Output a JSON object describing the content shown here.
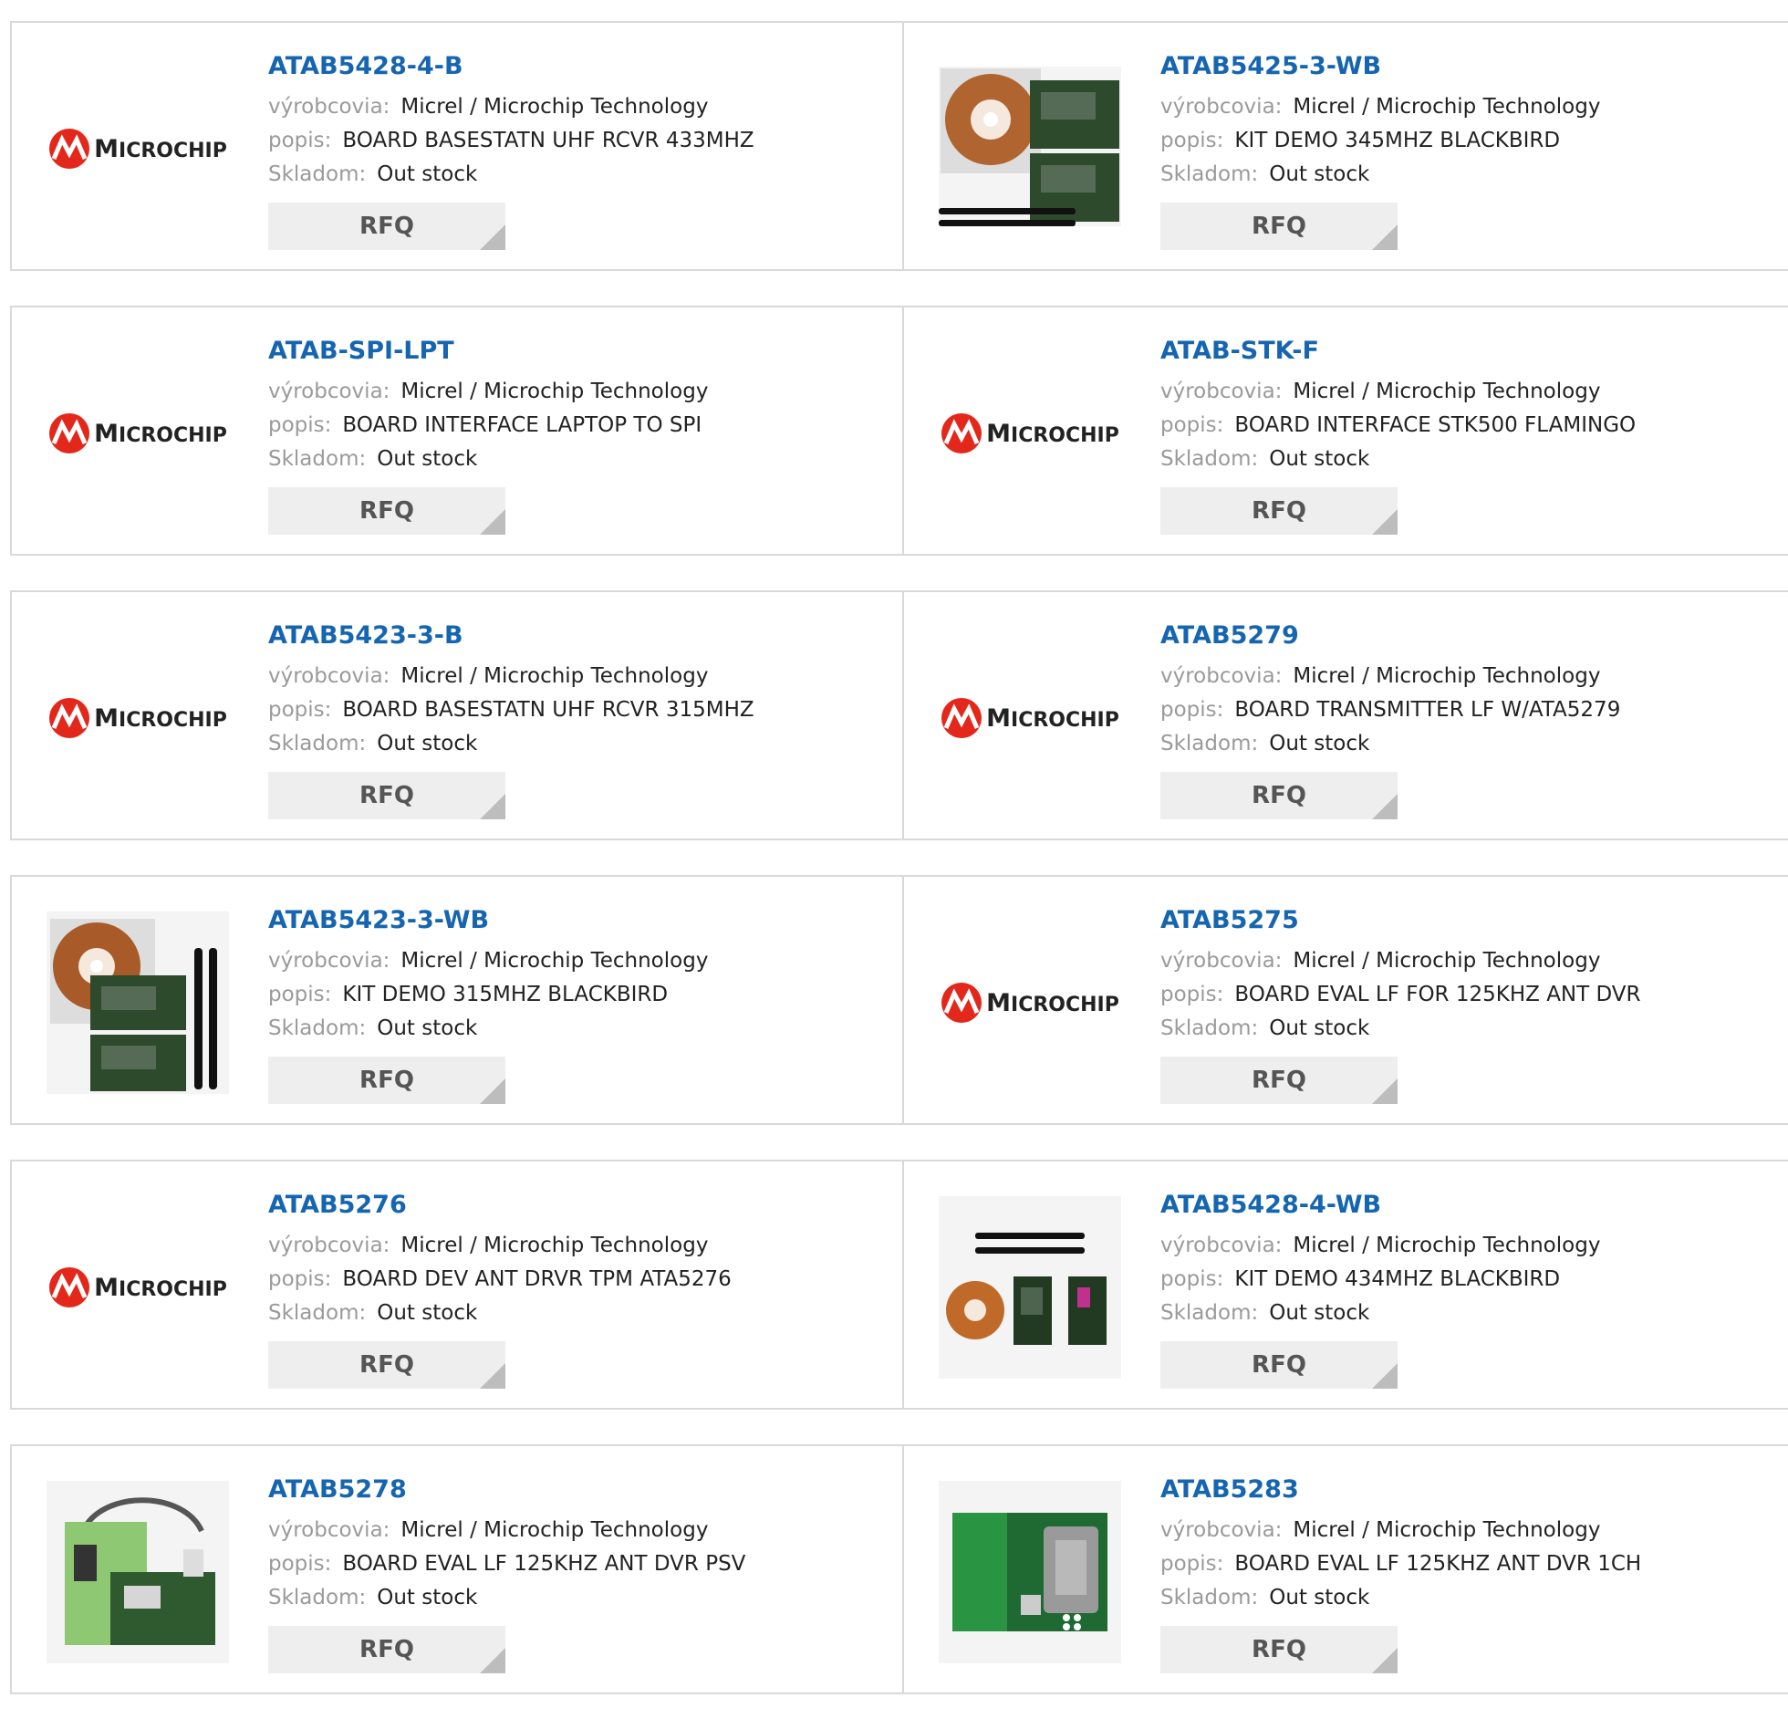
{
  "labels": {
    "manufacturer": "výrobcovia:",
    "description": "popis:",
    "stock": "Skladom:",
    "rfq": "RFQ"
  },
  "logo": {
    "brand_initial": "M",
    "brand_rest": "ICROCHIP"
  },
  "products": [
    {
      "part": "ATAB5428-4-B",
      "manufacturer": "Micrel / Microchip Technology",
      "description": "BOARD BASESTATN UHF RCVR 433MHZ",
      "stock": "Out stock",
      "image": "microchip-logo"
    },
    {
      "part": "ATAB5425-3-WB",
      "manufacturer": "Micrel / Microchip Technology",
      "description": "KIT DEMO 345MHZ BLACKBIRD",
      "stock": "Out stock",
      "image": "kit-photo-cd-boards-antennas"
    },
    {
      "part": "ATAB-SPI-LPT",
      "manufacturer": "Micrel / Microchip Technology",
      "description": "BOARD INTERFACE LAPTOP TO SPI",
      "stock": "Out stock",
      "image": "microchip-logo"
    },
    {
      "part": "ATAB-STK-F",
      "manufacturer": "Micrel / Microchip Technology",
      "description": "BOARD INTERFACE STK500 FLAMINGO",
      "stock": "Out stock",
      "image": "microchip-logo"
    },
    {
      "part": "ATAB5423-3-B",
      "manufacturer": "Micrel / Microchip Technology",
      "description": "BOARD BASESTATN UHF RCVR 315MHZ",
      "stock": "Out stock",
      "image": "microchip-logo"
    },
    {
      "part": "ATAB5279",
      "manufacturer": "Micrel / Microchip Technology",
      "description": "BOARD TRANSMITTER LF W/ATA5279",
      "stock": "Out stock",
      "image": "microchip-logo"
    },
    {
      "part": "ATAB5423-3-WB",
      "manufacturer": "Micrel / Microchip Technology",
      "description": "KIT DEMO 315MHZ BLACKBIRD",
      "stock": "Out stock",
      "image": "kit-photo-cd-boards-vertical-antennas"
    },
    {
      "part": "ATAB5275",
      "manufacturer": "Micrel / Microchip Technology",
      "description": "BOARD EVAL LF FOR 125KHZ ANT DVR",
      "stock": "Out stock",
      "image": "microchip-logo"
    },
    {
      "part": "ATAB5276",
      "manufacturer": "Micrel / Microchip Technology",
      "description": "BOARD DEV ANT DRVR TPM ATA5276",
      "stock": "Out stock",
      "image": "microchip-logo"
    },
    {
      "part": "ATAB5428-4-WB",
      "manufacturer": "Micrel / Microchip Technology",
      "description": "KIT DEMO 434MHZ BLACKBIRD",
      "stock": "Out stock",
      "image": "kit-photo-cd-small-boards"
    },
    {
      "part": "ATAB5278",
      "manufacturer": "Micrel / Microchip Technology",
      "description": "BOARD EVAL LF 125KHZ ANT DVR PSV",
      "stock": "Out stock",
      "image": "board-photo-green-cable"
    },
    {
      "part": "ATAB5283",
      "manufacturer": "Micrel / Microchip Technology",
      "description": "BOARD EVAL LF 125KHZ ANT DVR 1CH",
      "stock": "Out stock",
      "image": "board-photo-green-socket"
    }
  ]
}
